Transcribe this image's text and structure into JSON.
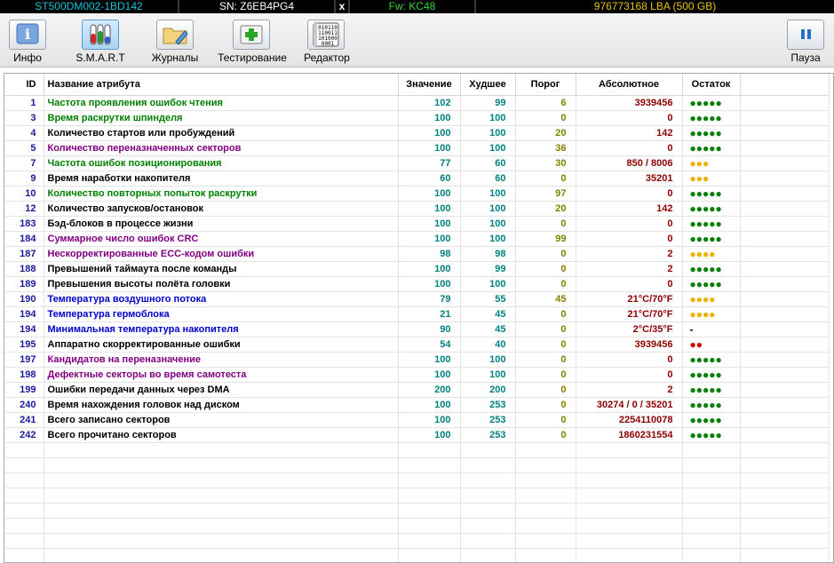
{
  "topbar": {
    "model": "ST500DM002-1BD142",
    "serial": "SN: Z6EB4PG4",
    "close": "x",
    "firmware": "Fw: KC48",
    "lba": "976773168 LBA (500 GB)"
  },
  "toolbar": {
    "info": "Инфо",
    "smart": "S.M.A.R.T",
    "logs": "Журналы",
    "testing": "Тестирование",
    "editor": "Редактор",
    "pause": "Пауза"
  },
  "table": {
    "headers": {
      "id": "ID",
      "name": "Название атрибута",
      "value": "Значение",
      "worst": "Худшее",
      "threshold": "Порог",
      "absolute": "Абсолютное",
      "remaining": "Остаток"
    },
    "name_colors": {
      "green": "#008000",
      "black": "#000000",
      "purple": "#800080",
      "blue": "#0000c8"
    },
    "rows": [
      {
        "id": "1",
        "name": "Частота проявления ошибок чтения",
        "color": "green",
        "value": "102",
        "worst": "99",
        "threshold": "6",
        "absolute": "3939456",
        "remaining": "●●●●●",
        "rem_color": "#008000"
      },
      {
        "id": "3",
        "name": "Время раскрутки шпинделя",
        "color": "green",
        "value": "100",
        "worst": "100",
        "threshold": "0",
        "absolute": "0",
        "remaining": "●●●●●",
        "rem_color": "#008000"
      },
      {
        "id": "4",
        "name": "Количество стартов или пробуждений",
        "color": "black",
        "value": "100",
        "worst": "100",
        "threshold": "20",
        "absolute": "142",
        "remaining": "●●●●●",
        "rem_color": "#008000"
      },
      {
        "id": "5",
        "name": "Количество переназначенных секторов",
        "color": "purple",
        "value": "100",
        "worst": "100",
        "threshold": "36",
        "absolute": "0",
        "remaining": "●●●●●",
        "rem_color": "#008000"
      },
      {
        "id": "7",
        "name": "Частота ошибок позиционирования",
        "color": "green",
        "value": "77",
        "worst": "60",
        "threshold": "30",
        "absolute": "850 / 8006",
        "remaining": "●●●",
        "rem_color": "#f0b000"
      },
      {
        "id": "9",
        "name": "Время наработки накопителя",
        "color": "black",
        "value": "60",
        "worst": "60",
        "threshold": "0",
        "absolute": "35201",
        "remaining": "●●●",
        "rem_color": "#f0b000"
      },
      {
        "id": "10",
        "name": "Количество повторных попыток раскрутки",
        "color": "green",
        "value": "100",
        "worst": "100",
        "threshold": "97",
        "absolute": "0",
        "remaining": "●●●●●",
        "rem_color": "#008000"
      },
      {
        "id": "12",
        "name": "Количество запусков/остановок",
        "color": "black",
        "value": "100",
        "worst": "100",
        "threshold": "20",
        "absolute": "142",
        "remaining": "●●●●●",
        "rem_color": "#008000"
      },
      {
        "id": "183",
        "name": "Бэд-блоков в процессе жизни",
        "color": "black",
        "value": "100",
        "worst": "100",
        "threshold": "0",
        "absolute": "0",
        "remaining": "●●●●●",
        "rem_color": "#008000"
      },
      {
        "id": "184",
        "name": "Суммарное число ошибок CRC",
        "color": "purple",
        "value": "100",
        "worst": "100",
        "threshold": "99",
        "absolute": "0",
        "remaining": "●●●●●",
        "rem_color": "#008000"
      },
      {
        "id": "187",
        "name": "Нескорректированные ECC-кодом ошибки",
        "color": "purple",
        "value": "98",
        "worst": "98",
        "threshold": "0",
        "absolute": "2",
        "remaining": "●●●●",
        "rem_color": "#f0b000"
      },
      {
        "id": "188",
        "name": "Превышений таймаута после команды",
        "color": "black",
        "value": "100",
        "worst": "99",
        "threshold": "0",
        "absolute": "2",
        "remaining": "●●●●●",
        "rem_color": "#008000"
      },
      {
        "id": "189",
        "name": "Превышения высоты полёта головки",
        "color": "black",
        "value": "100",
        "worst": "100",
        "threshold": "0",
        "absolute": "0",
        "remaining": "●●●●●",
        "rem_color": "#008000"
      },
      {
        "id": "190",
        "name": "Температура воздушного потока",
        "color": "blue",
        "value": "79",
        "worst": "55",
        "threshold": "45",
        "absolute": "21°C/70°F",
        "remaining": "●●●●",
        "rem_color": "#f0b000"
      },
      {
        "id": "194",
        "name": "Температура гермоблока",
        "color": "blue",
        "value": "21",
        "worst": "45",
        "threshold": "0",
        "absolute": "21°C/70°F",
        "remaining": "●●●●",
        "rem_color": "#f0b000"
      },
      {
        "id": "194",
        "name": "Минимальная температура накопителя",
        "color": "blue",
        "value": "90",
        "worst": "45",
        "threshold": "0",
        "absolute": "2°C/35°F",
        "remaining": "-",
        "rem_color": "#000000"
      },
      {
        "id": "195",
        "name": "Аппаратно скорректированные ошибки",
        "color": "black",
        "value": "54",
        "worst": "40",
        "threshold": "0",
        "absolute": "3939456",
        "remaining": "●●",
        "rem_color": "#d00000"
      },
      {
        "id": "197",
        "name": "Кандидатов на переназначение",
        "color": "purple",
        "value": "100",
        "worst": "100",
        "threshold": "0",
        "absolute": "0",
        "remaining": "●●●●●",
        "rem_color": "#008000"
      },
      {
        "id": "198",
        "name": "Дефектные секторы во время самотеста",
        "color": "purple",
        "value": "100",
        "worst": "100",
        "threshold": "0",
        "absolute": "0",
        "remaining": "●●●●●",
        "rem_color": "#008000"
      },
      {
        "id": "199",
        "name": "Ошибки передачи данных через DMA",
        "color": "black",
        "value": "200",
        "worst": "200",
        "threshold": "0",
        "absolute": "2",
        "remaining": "●●●●●",
        "rem_color": "#008000"
      },
      {
        "id": "240",
        "name": "Время нахождения головок над диском",
        "color": "black",
        "value": "100",
        "worst": "253",
        "threshold": "0",
        "absolute": "30274 / 0 / 35201",
        "remaining": "●●●●●",
        "rem_color": "#008000"
      },
      {
        "id": "241",
        "name": "Всего записано секторов",
        "color": "black",
        "value": "100",
        "worst": "253",
        "threshold": "0",
        "absolute": "2254110078",
        "remaining": "●●●●●",
        "rem_color": "#008000"
      },
      {
        "id": "242",
        "name": "Всего прочитано секторов",
        "color": "black",
        "value": "100",
        "worst": "253",
        "threshold": "0",
        "absolute": "1860231554",
        "remaining": "●●●●●",
        "rem_color": "#008000"
      }
    ]
  }
}
